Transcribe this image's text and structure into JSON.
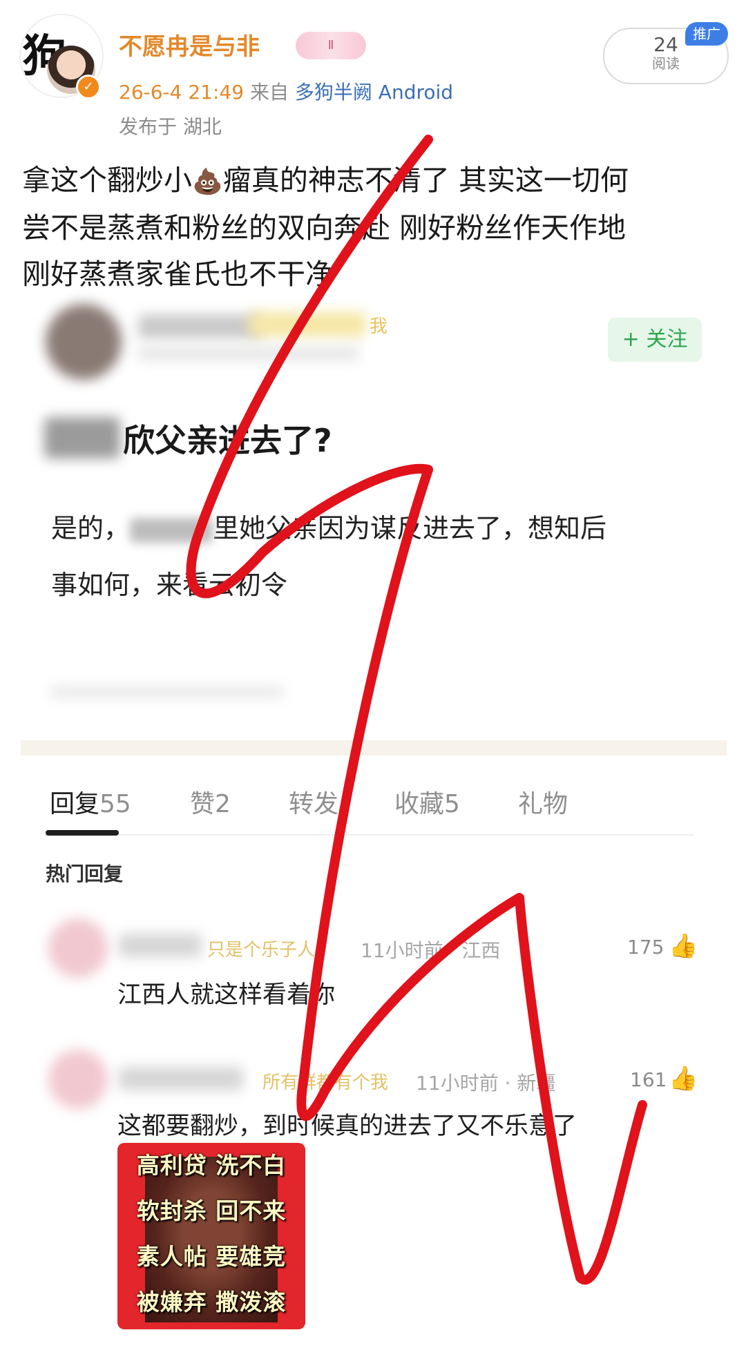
{
  "post": {
    "username": "不愿冉是与非",
    "badge": "Ⅱ",
    "time": "26-6-4 21:49",
    "from_label": "来自",
    "source": "多狗半阙 Android",
    "location": "发布于 湖北",
    "read_count": "24",
    "read_label": "阅读",
    "promo_label": "推广",
    "text_line1_a": "拿这个翻炒小",
    "text_line1_b": "瘤真的神志不清了  其实这一切何",
    "text_line2": "尝不是蒸煮和粉丝的双向奔赴   刚好粉丝作天作地",
    "text_line3": "刚好蒸煮家雀氏也不干净"
  },
  "embedded": {
    "name_tail": "我",
    "follow_label": "+ 关注",
    "title": "欣父亲进去了?",
    "body_a": "是的，",
    "body_b": "里她父亲因为谋反进去了，想知后",
    "body_line2": "事如何，来看云初令"
  },
  "tabs": [
    {
      "label": "回复",
      "count": "55"
    },
    {
      "label": "赞",
      "count": "2"
    },
    {
      "label": "转发",
      "count": ""
    },
    {
      "label": "收藏",
      "count": "5"
    },
    {
      "label": "礼物",
      "count": ""
    }
  ],
  "hot_replies_title": "热门回复",
  "replies": [
    {
      "tag": "只是个乐子人",
      "meta": "11小时前 · 江西",
      "likes": "175",
      "text": "江西人就这样看着你"
    },
    {
      "tag": "所有群都有个我",
      "meta": "11小时前 · 新疆",
      "likes": "161",
      "text": "这都要翻炒，到时候真的进去了又不乐意了"
    }
  ],
  "meme_lines": [
    "高利贷 洗不白",
    "软封杀 回不来",
    "素人帖 要雄竞",
    "被嫌弃 撒泼滚"
  ],
  "colors": {
    "username": "#e3892a",
    "source_link": "#3b6fb6",
    "follow_green": "#2aa64b",
    "scribble_red": "#e0121b",
    "meme_bg": "#e3262b"
  }
}
